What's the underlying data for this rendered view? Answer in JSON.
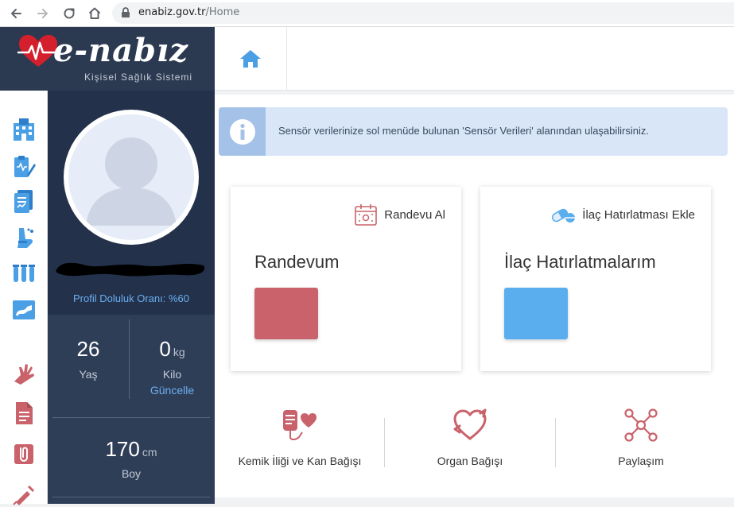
{
  "browser": {
    "url_domain": "enabiz.gov.tr",
    "url_path": "/Home"
  },
  "logo": {
    "wordmark": "e-nabız",
    "subtitle": "Kişisel Sağlık Sistemi"
  },
  "sidebar": {
    "icons": [
      "hospital-icon",
      "medical-report-icon",
      "lab-results-icon",
      "inhaler-icon",
      "test-tubes-icon",
      "radiology-icon",
      "hand-injury-icon",
      "document-icon",
      "attachment-icon",
      "vaccine-icon"
    ]
  },
  "profile": {
    "completion_text": "Profil Doluluk Oranı: %60",
    "age": {
      "value": "26",
      "label": "Yaş"
    },
    "weight": {
      "value": "0",
      "unit": "kg",
      "label": "Kilo",
      "update_link": "Güncelle"
    },
    "height": {
      "value": "170",
      "unit": "cm",
      "label": "Boy"
    }
  },
  "info": {
    "message": "Sensör verilerinize sol menüde bulunan 'Sensör Verileri' alanından ulaşabilirsiniz."
  },
  "cards": {
    "appointment": {
      "action": "Randevu Al",
      "title": "Randevum",
      "color": "#c9626a"
    },
    "medication": {
      "action": "İlaç Hatırlatması Ekle",
      "title": "İlaç Hatırlatmalarım",
      "color": "#5aaeed"
    }
  },
  "donations": [
    {
      "label": "Kemik İliği ve Kan Bağışı",
      "icon": "blood-donation-icon"
    },
    {
      "label": "Organ Bağışı",
      "icon": "organ-donation-icon"
    },
    {
      "label": "Paylaşım",
      "icon": "share-network-icon"
    }
  ],
  "colors": {
    "navy": "#23314a",
    "accent_red": "#c9626a",
    "accent_blue": "#5aaeed",
    "info_bg": "#d8e6f8"
  }
}
